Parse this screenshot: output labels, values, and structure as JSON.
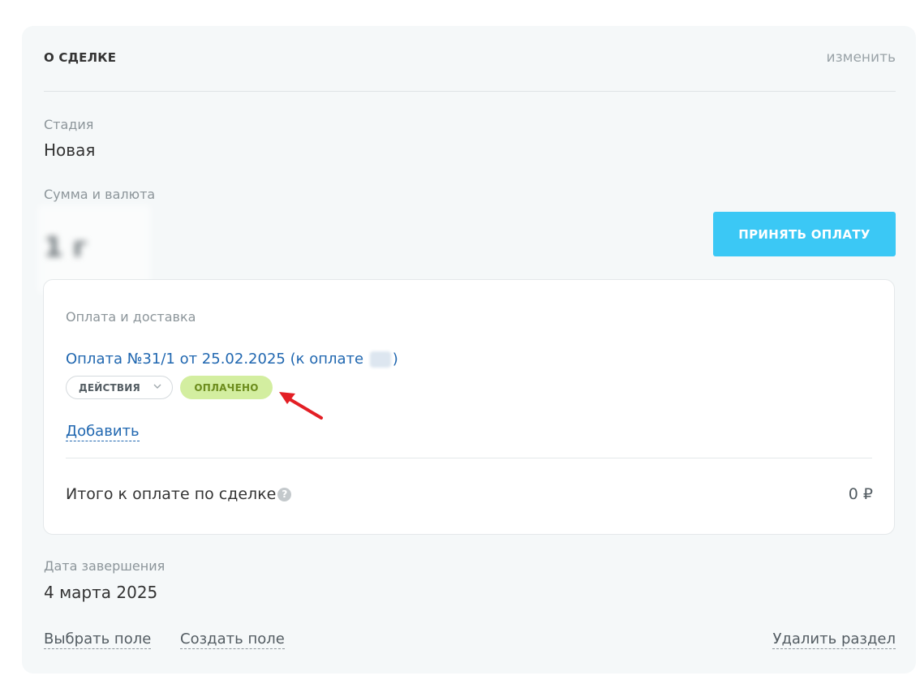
{
  "section": {
    "title": "О СДЕЛКЕ",
    "edit_label": "изменить"
  },
  "fields": {
    "stage_label": "Стадия",
    "stage_value": "Новая",
    "amount_label": "Сумма и валюта",
    "amount_value": "1 г",
    "end_date_label": "Дата завершения",
    "end_date_value": "4 марта 2025"
  },
  "pay_button_label": "ПРИНЯТЬ ОПЛАТУ",
  "payment_card": {
    "label": "Оплата и доставка",
    "payment_link_prefix": "Оплата №31/1 от 25.02.2025 (к оплате ",
    "payment_link_suffix": ")",
    "actions_label": "ДЕЙСТВИЯ",
    "status_badge": "ОПЛАЧЕНО",
    "add_label": "Добавить",
    "total_label": "Итого к оплате по сделке",
    "total_value": "0 ₽"
  },
  "bottom_links": {
    "select_field": "Выбрать поле",
    "create_field": "Создать поле",
    "delete_section": "Удалить раздел"
  },
  "colors": {
    "accent_button": "#3bc8f5",
    "link": "#2067b0",
    "paid_badge_bg": "#d3eea0",
    "paid_badge_text": "#6c8c1c",
    "annotation_arrow": "#e31e24"
  },
  "icons": [
    "chevron-down-icon",
    "help-icon",
    "annotation-arrow-icon"
  ]
}
